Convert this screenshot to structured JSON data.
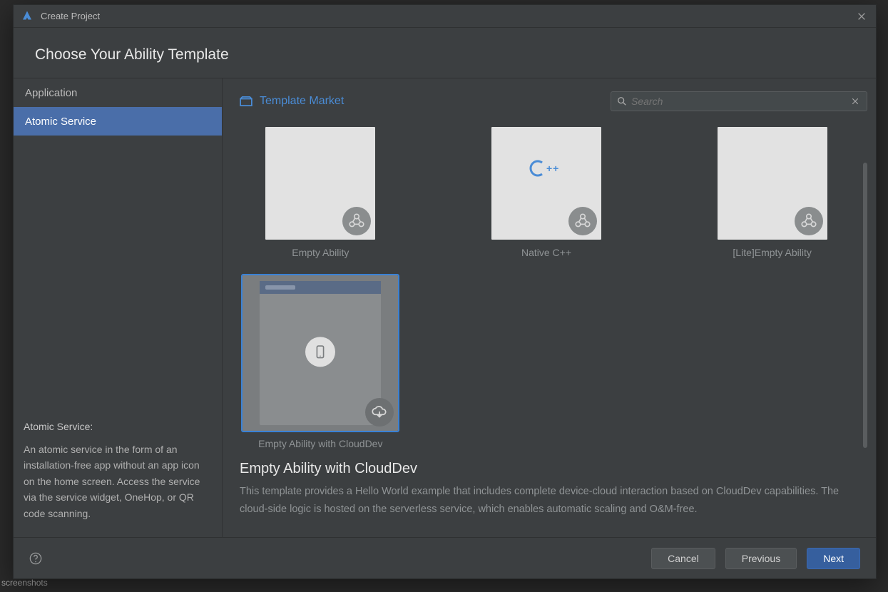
{
  "titlebar": {
    "title": "Create Project"
  },
  "header": "Choose Your Ability Template",
  "sidebar": {
    "items": [
      {
        "label": "Application",
        "selected": false
      },
      {
        "label": "Atomic Service",
        "selected": true
      }
    ],
    "desc_title": "Atomic Service:",
    "desc_body": "An atomic service in the form of an installation-free app without an app icon on the home screen. Access the service via the service widget, OneHop, or QR code scanning."
  },
  "main": {
    "market_link": "Template Market",
    "search_placeholder": "Search",
    "templates": [
      {
        "id": "empty-ability",
        "label": "Empty Ability",
        "kind": "ability",
        "selected": false
      },
      {
        "id": "native-cpp",
        "label": "Native C++",
        "kind": "cpp",
        "selected": false
      },
      {
        "id": "lite-empty-ability",
        "label": "[Lite]Empty Ability",
        "kind": "ability",
        "selected": false
      },
      {
        "id": "empty-ability-clouddev",
        "label": "Empty Ability with CloudDev",
        "kind": "cloud",
        "selected": true
      }
    ],
    "detail": {
      "title": "Empty Ability with CloudDev",
      "text": "This template provides a Hello World example that includes complete device-cloud interaction based on CloudDev capabilities. The cloud-side logic is hosted on the serverless service, which enables automatic scaling and O&M-free."
    }
  },
  "footer": {
    "cancel": "Cancel",
    "previous": "Previous",
    "next": "Next"
  },
  "background_hint": "screenshots"
}
